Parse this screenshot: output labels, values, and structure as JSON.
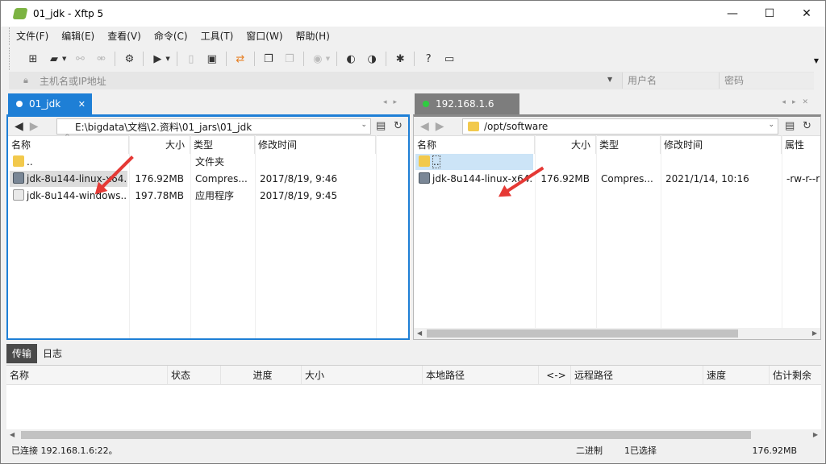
{
  "window": {
    "title": "01_jdk - Xftp 5",
    "minimize": "—",
    "maximize": "☐",
    "close": "✕"
  },
  "menu": [
    "文件(F)",
    "编辑(E)",
    "查看(V)",
    "命令(C)",
    "工具(T)",
    "窗口(W)",
    "帮助(H)"
  ],
  "address": {
    "host_placeholder": "主机名或IP地址",
    "user_placeholder": "用户名",
    "password_placeholder": "密码"
  },
  "left_pane": {
    "tab_label": "01_jdk",
    "tab_dot_color": "#ffffff",
    "path": "E:\\bigdata\\文档\\2.资料\\01_jars\\01_jdk",
    "columns": [
      "名称",
      "大小",
      "类型",
      "修改时间"
    ],
    "rows": [
      {
        "name": "..",
        "size": "",
        "type": "文件夹",
        "modified": "",
        "icon": "folder-icon"
      },
      {
        "name": "jdk-8u144-linux-x64...",
        "size": "176.92MB",
        "type": "Compres...",
        "modified": "2017/8/19, 9:46",
        "icon": "archive-icon"
      },
      {
        "name": "jdk-8u144-windows...",
        "size": "197.78MB",
        "type": "应用程序",
        "modified": "2017/8/19, 9:45",
        "icon": "java-icon"
      }
    ]
  },
  "right_pane": {
    "tab_label": "192.168.1.6",
    "tab_dot_color": "#2ecc40",
    "path": "/opt/software",
    "columns": [
      "名称",
      "大小",
      "类型",
      "修改时间",
      "属性"
    ],
    "rows": [
      {
        "name": "..",
        "size": "",
        "type": "",
        "modified": "",
        "attrs": "",
        "icon": "folder-icon"
      },
      {
        "name": "jdk-8u144-linux-x64...",
        "size": "176.92MB",
        "type": "Compres...",
        "modified": "2021/1/14, 10:16",
        "attrs": "-rw-r--r",
        "icon": "archive-icon"
      }
    ]
  },
  "transfer": {
    "tabs": [
      "传输",
      "日志"
    ],
    "columns": [
      "名称",
      "状态",
      "进度",
      "大小",
      "本地路径",
      "<->",
      "远程路径",
      "速度",
      "估计剩余"
    ]
  },
  "status": {
    "connection": "已连接 192.168.1.6:22。",
    "mode": "二进制",
    "selection": "1已选择",
    "size": "176.92MB"
  },
  "colors": {
    "accent": "#1e7fd6",
    "annotation_arrow": "#e53935"
  }
}
